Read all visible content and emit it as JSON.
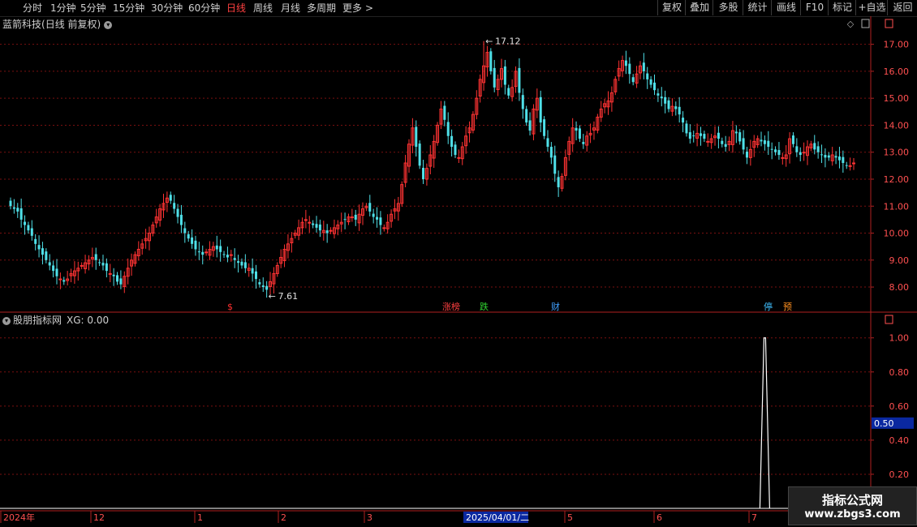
{
  "toolbar": {
    "periods": [
      {
        "label": "分时"
      },
      {
        "label": "1分钟"
      },
      {
        "label": "5分钟"
      },
      {
        "label": "15分钟"
      },
      {
        "label": "30分钟"
      },
      {
        "label": "60分钟"
      },
      {
        "label": "日线",
        "active": true
      },
      {
        "label": "周线"
      },
      {
        "label": "月线"
      },
      {
        "label": "多周期"
      },
      {
        "label": "更多"
      }
    ],
    "more_arrow": ">",
    "right_buttons": [
      "复权",
      "叠加",
      "多股",
      "统计",
      "画线",
      "F10",
      "标记",
      "+自选",
      "返回"
    ]
  },
  "stock": {
    "name": "蓝箭科技",
    "mode": "(日线 前复权)",
    "high_label": "17.12",
    "low_label": "7.61"
  },
  "indicator": {
    "name": "股朋指标网",
    "value_label": "XG: 0.00",
    "cursor_value": "0.50"
  },
  "time_axis": {
    "labels": [
      "2024年",
      "12",
      "1",
      "2",
      "3",
      "5",
      "6",
      "7"
    ],
    "cursor_date": "2025/04/01/二"
  },
  "event_markers": [
    {
      "text": "$",
      "color": "#ff3030"
    },
    {
      "text": "涨榜",
      "color": "#ff4040"
    },
    {
      "text": "跌",
      "color": "#30d030"
    },
    {
      "text": "财",
      "color": "#40a0ff"
    },
    {
      "text": "停",
      "color": "#40c0ff"
    },
    {
      "text": "预",
      "color": "#ff9020"
    }
  ],
  "watermark": {
    "line1": "指标公式网",
    "line2": "www.zbgs3.com"
  },
  "colors": {
    "up": "#ff3333",
    "down": "#4fe0e8",
    "grid": "#7a1010",
    "axis": "#b02020",
    "signal": "#ffffff"
  },
  "chart_data": [
    {
      "type": "candlestick",
      "title": "蓝箭科技(日线 前复权)",
      "y_ticks": [
        8.0,
        9.0,
        10.0,
        11.0,
        12.0,
        13.0,
        14.0,
        15.0,
        16.0,
        17.0
      ],
      "ylim": [
        7.1,
        17.5
      ],
      "marked_high": 17.12,
      "marked_low": 7.61,
      "close_series": [
        11.0,
        10.9,
        10.8,
        10.5,
        10.3,
        10.1,
        9.9,
        9.6,
        9.4,
        9.2,
        9.0,
        8.8,
        8.6,
        8.4,
        8.3,
        8.2,
        8.3,
        8.5,
        8.6,
        8.7,
        8.8,
        8.9,
        9.0,
        9.1,
        9.0,
        8.9,
        8.8,
        8.6,
        8.5,
        8.4,
        8.2,
        8.1,
        8.4,
        8.7,
        9.0,
        9.2,
        9.4,
        9.6,
        9.8,
        10.0,
        10.3,
        10.6,
        10.9,
        11.1,
        11.3,
        11.2,
        10.9,
        10.6,
        10.3,
        10.0,
        9.8,
        9.6,
        9.4,
        9.3,
        9.2,
        9.3,
        9.4,
        9.5,
        9.4,
        9.3,
        9.2,
        9.1,
        9.2,
        9.0,
        8.9,
        8.8,
        8.7,
        8.7,
        8.5,
        8.3,
        8.1,
        8.0,
        7.9,
        8.2,
        8.5,
        8.8,
        9.1,
        9.4,
        9.6,
        9.8,
        10.0,
        10.2,
        10.4,
        10.5,
        10.4,
        10.3,
        10.2,
        10.1,
        10.1,
        10.0,
        10.1,
        10.2,
        10.3,
        10.4,
        10.5,
        10.6,
        10.6,
        10.5,
        10.7,
        10.9,
        11.0,
        10.8,
        10.6,
        10.5,
        10.3,
        10.2,
        10.4,
        10.7,
        10.9,
        11.1,
        11.8,
        12.6,
        13.3,
        13.9,
        13.2,
        12.5,
        12.0,
        12.4,
        12.9,
        13.4,
        14.0,
        14.6,
        14.2,
        13.6,
        13.2,
        12.9,
        12.8,
        13.2,
        13.6,
        13.9,
        14.4,
        15.0,
        15.7,
        16.2,
        16.7,
        16.0,
        15.4,
        15.7,
        16.1,
        15.5,
        15.1,
        15.4,
        16.0,
        15.2,
        14.6,
        14.1,
        13.8,
        14.6,
        15.0,
        14.1,
        13.6,
        13.2,
        12.8,
        12.2,
        11.7,
        12.1,
        12.8,
        13.4,
        13.9,
        13.8,
        13.5,
        13.3,
        13.6,
        13.7,
        13.9,
        14.3,
        14.6,
        14.8,
        14.9,
        15.2,
        15.7,
        16.1,
        16.4,
        16.2,
        15.9,
        15.6,
        15.9,
        16.2,
        16.0,
        15.7,
        15.5,
        15.3,
        15.1,
        15.0,
        14.8,
        14.6,
        14.7,
        14.6,
        14.4,
        14.1,
        13.7,
        13.5,
        13.6,
        13.7,
        13.6,
        13.5,
        13.4,
        13.5,
        13.6,
        13.5,
        13.3,
        13.2,
        13.4,
        13.8,
        13.7,
        13.4,
        13.1,
        12.8,
        13.1,
        13.4,
        13.5,
        13.4,
        13.3,
        13.2,
        13.1,
        13.0,
        12.9,
        12.8,
        12.9,
        13.5,
        13.3,
        13.0,
        12.9,
        13.0,
        13.2,
        13.3,
        13.1,
        13.0,
        12.9,
        12.8,
        12.8,
        12.9,
        12.8,
        12.7,
        12.6,
        12.5,
        12.5,
        12.6
      ]
    },
    {
      "type": "line",
      "title": "股朋指标网",
      "series": [
        {
          "name": "XG",
          "spikes": [
            {
              "date_index": 212,
              "value": 1.0
            }
          ]
        }
      ],
      "y_ticks": [
        0.2,
        0.4,
        0.6,
        0.8,
        1.0
      ],
      "ylim": [
        0.0,
        1.07
      ]
    }
  ]
}
